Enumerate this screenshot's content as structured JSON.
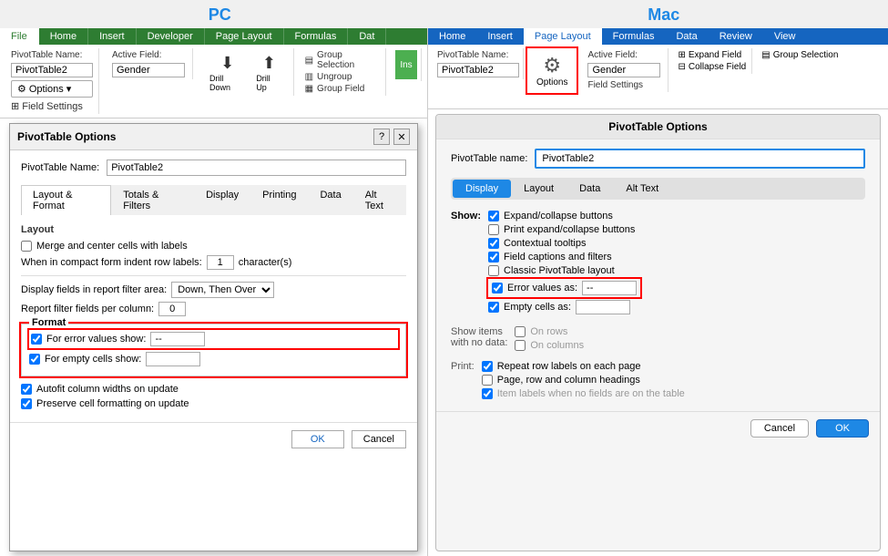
{
  "title_bar": {
    "pc_label": "PC",
    "mac_label": "Mac"
  },
  "pc": {
    "ribbon": {
      "tabs": [
        "File",
        "Home",
        "Insert",
        "Developer",
        "Page Layout",
        "Formulas",
        "Dat"
      ],
      "active_tab": "Home",
      "pivot_name_label": "PivotTable Name:",
      "pivot_name_value": "PivotTable2",
      "options_label": "Options",
      "active_field_label": "Active Field:",
      "active_field_value": "Gender",
      "field_settings_label": "Field Settings",
      "drill_down_label": "Drill Down",
      "drill_up_label": "Drill Up",
      "group_selection_label": "Group Selection",
      "ungroup_label": "Ungroup",
      "group_field_label": "Group Field",
      "insert_label": "Ins"
    },
    "dialog": {
      "title": "PivotTable Options",
      "pivot_name_label": "PivotTable Name:",
      "pivot_name_value": "PivotTable2",
      "tabs": [
        "Layout & Format",
        "Totals & Filters",
        "Display",
        "Printing",
        "Data",
        "Alt Text"
      ],
      "active_tab": "Layout & Format",
      "layout_section": "Layout",
      "merge_label": "Merge and center cells with labels",
      "indent_label": "When in compact form indent row labels:",
      "indent_value": "1",
      "indent_suffix": "character(s)",
      "display_fields_label": "Display fields in report filter area:",
      "display_fields_value": "Down, Then Over",
      "report_filter_label": "Report filter fields per column:",
      "report_filter_value": "0",
      "format_section": "Format",
      "for_error_label": "For error values show:",
      "for_error_value": "--",
      "for_empty_label": "For empty cells show:",
      "for_empty_value": "",
      "autofit_label": "Autofit column widths on update",
      "preserve_label": "Preserve cell formatting on update",
      "ok_label": "OK",
      "cancel_label": "Cancel"
    }
  },
  "mac": {
    "ribbon": {
      "tabs": [
        "Home",
        "Insert",
        "Page Layout",
        "Formulas",
        "Data",
        "Review",
        "View"
      ],
      "active_tab": "Home",
      "pivot_name_label": "PivotTable Name:",
      "pivot_name_value": "PivotTable2",
      "options_label": "Options",
      "active_field_label": "Active Field:",
      "active_field_value": "Gender",
      "field_settings_label": "Field Settings",
      "expand_field_label": "Expand Field",
      "collapse_field_label": "Collapse Field",
      "group_selection_label": "Group Selection"
    },
    "dialog": {
      "title": "PivotTable Options",
      "pivot_name_label": "PivotTable name:",
      "pivot_name_value": "PivotTable2",
      "tabs": [
        "Display",
        "Layout",
        "Data",
        "Alt Text"
      ],
      "active_tab": "Display",
      "show_label": "Show:",
      "expand_collapse_label": "Expand/collapse buttons",
      "print_expand_label": "Print expand/collapse buttons",
      "contextual_label": "Contextual tooltips",
      "field_captions_label": "Field captions and filters",
      "classic_layout_label": "Classic PivotTable layout",
      "error_values_label": "Error values as:",
      "error_values_value": "--",
      "empty_cells_label": "Empty cells as:",
      "empty_cells_value": "",
      "show_items_label": "Show items with no data:",
      "on_rows_label": "On rows",
      "on_columns_label": "On columns",
      "print_label": "Print:",
      "repeat_row_label": "Repeat row labels on each page",
      "page_row_col_label": "Page, row and column headings",
      "item_labels_label": "Item labels when no fields are on the table",
      "ok_label": "OK",
      "cancel_label": "Cancel"
    }
  }
}
